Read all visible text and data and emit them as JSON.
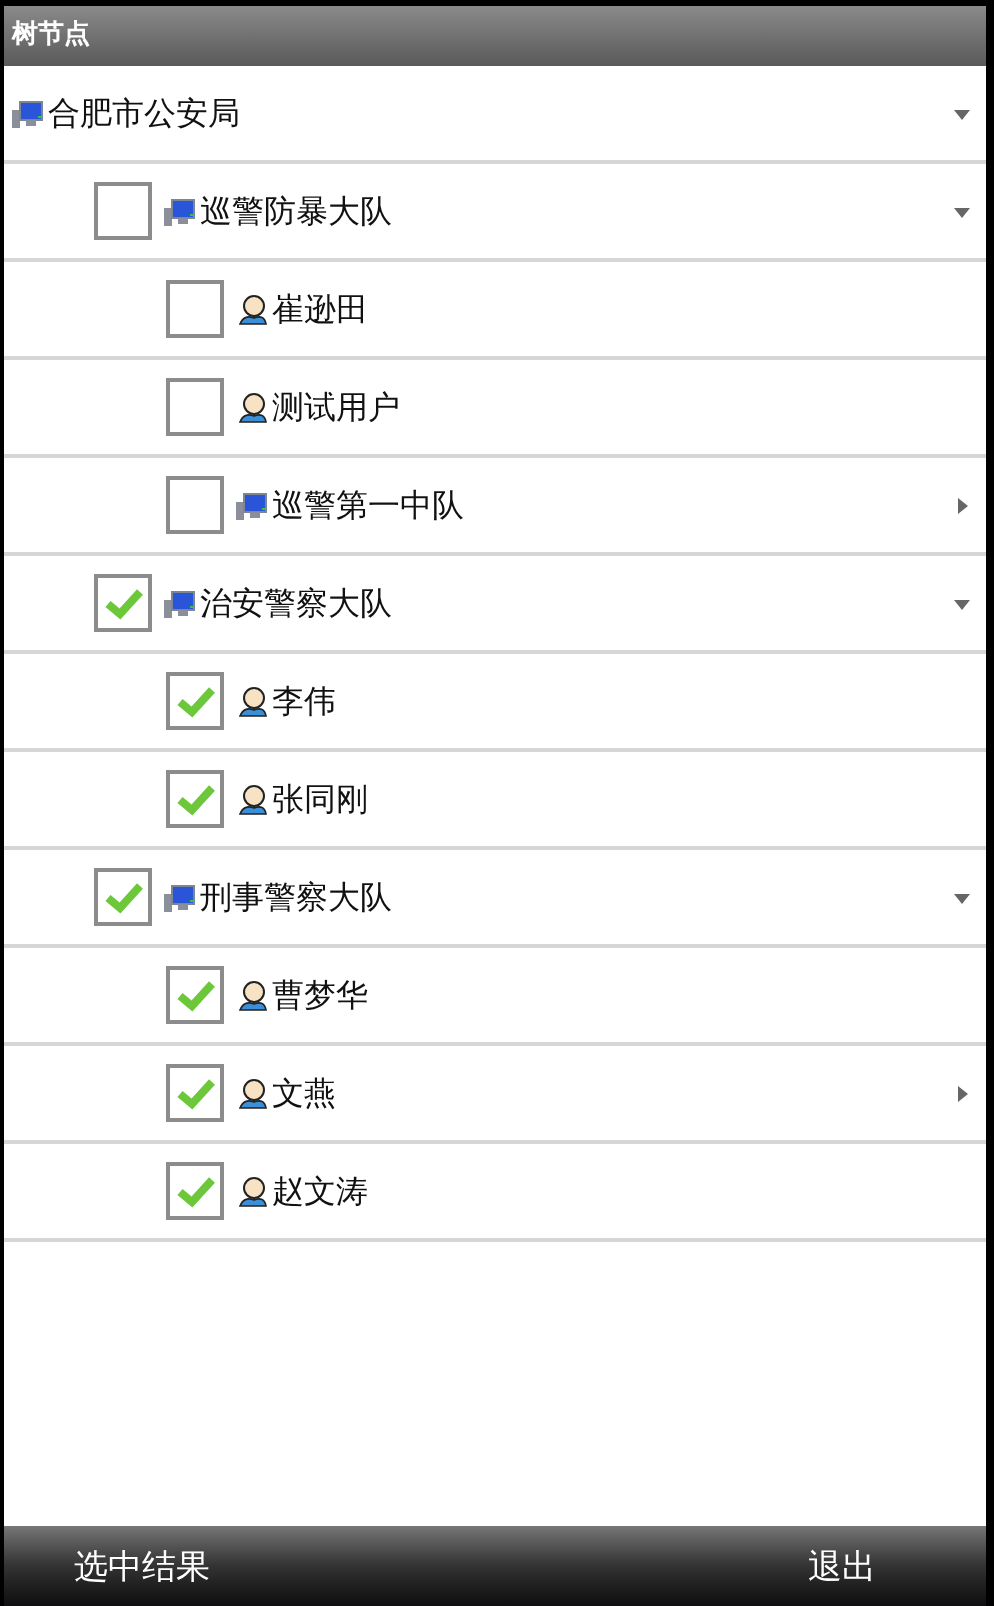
{
  "title": "树节点",
  "tree": [
    {
      "kind": "unit",
      "label": "合肥市公安局",
      "expanded": true,
      "children": [
        {
          "kind": "unit",
          "label": "巡警防暴大队",
          "checked": false,
          "expanded": true,
          "children": [
            {
              "kind": "user",
              "label": "崔逊田",
              "checked": false
            },
            {
              "kind": "user",
              "label": "测试用户",
              "checked": false
            },
            {
              "kind": "unit",
              "label": "巡警第一中队",
              "checked": false,
              "expanded": false
            }
          ]
        },
        {
          "kind": "unit",
          "label": "治安警察大队",
          "checked": true,
          "expanded": true,
          "children": [
            {
              "kind": "user",
              "label": "李伟",
              "checked": true
            },
            {
              "kind": "user",
              "label": "张同刚",
              "checked": true
            }
          ]
        },
        {
          "kind": "unit",
          "label": "刑事警察大队",
          "checked": true,
          "expanded": true,
          "children": [
            {
              "kind": "user",
              "label": "曹梦华",
              "checked": true
            },
            {
              "kind": "user",
              "label": "文燕",
              "checked": true,
              "expanded": false
            },
            {
              "kind": "user",
              "label": "赵文涛",
              "checked": true
            }
          ]
        }
      ]
    }
  ],
  "buttons": [
    "选中结果",
    "退出"
  ]
}
